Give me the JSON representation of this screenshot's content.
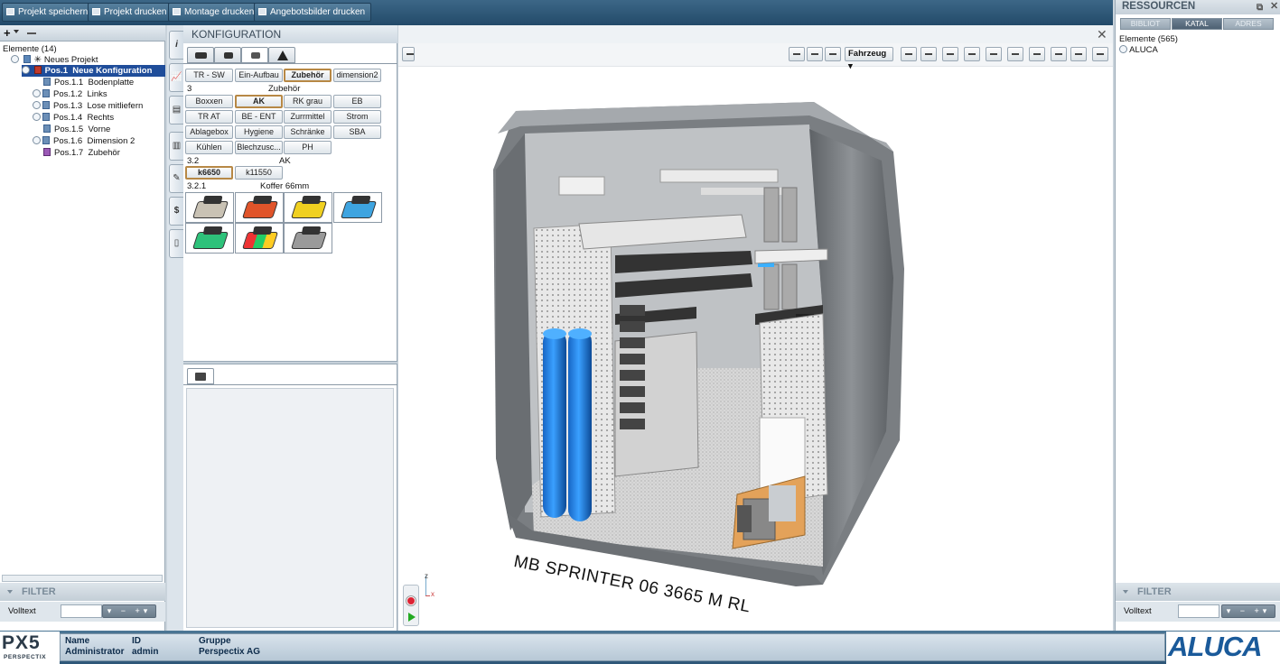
{
  "toolbar": {
    "save": "Projekt speichern",
    "print": "Projekt drucken",
    "assembly_print": "Montage drucken",
    "offer_images_print": "Angebotsbilder drucken"
  },
  "tree": {
    "header": "Elemente (14)",
    "root": "Neues Projekt",
    "selected_code": "Pos.1",
    "selected_label": "Neue Konfiguration",
    "items": [
      {
        "code": "Pos.1.1",
        "label": "Bodenplatte"
      },
      {
        "code": "Pos.1.2",
        "label": "Links"
      },
      {
        "code": "Pos.1.3",
        "label": "Lose mitliefern"
      },
      {
        "code": "Pos.1.4",
        "label": "Rechts"
      },
      {
        "code": "Pos.1.5",
        "label": "Vorne"
      },
      {
        "code": "Pos.1.6",
        "label": "Dimension 2"
      },
      {
        "code": "Pos.1.7",
        "label": "Zubehör"
      }
    ]
  },
  "filter": {
    "title": "FILTER",
    "volltext": "Volltext"
  },
  "config": {
    "title": "KONFIGURATION",
    "top_buttons": [
      "TR - SW",
      "Ein-Aufbau",
      "Zubehör",
      "dimension2"
    ],
    "level1_num": "3",
    "level1_name": "Zubehör",
    "grid_buttons": [
      "Boxxen",
      "AK",
      "RK grau",
      "EB",
      "TR AT",
      "BE - ENT",
      "Zurrmittel",
      "Strom",
      "Ablagebox",
      "Hygiene",
      "Schränke",
      "SBA",
      "Kühlen",
      "Blechzusc...",
      "PH"
    ],
    "level2_num": "3.2",
    "level2_name": "AK",
    "sub_buttons": [
      "k6650",
      "k11550"
    ],
    "level3_num": "3.2.1",
    "level3_name": "Koffer 66mm"
  },
  "viewport": {
    "vehicle_dropdown": "Fahrzeug",
    "vehicle_label": "MB SPRINTER 06 3665 M RL",
    "axis_z": "z",
    "axis_x": "x"
  },
  "resources": {
    "title": "RESSOURCEN",
    "tabs": [
      "BIBLIOT",
      "KATAL",
      "ADRES"
    ],
    "count": "Elemente (565)",
    "item": "ALUCA",
    "filter_title": "FILTER",
    "volltext": "Volltext"
  },
  "status": {
    "logo": "PX5",
    "logo_sub": "PERSPECTIX",
    "name_label": "Name",
    "name_value": "Administrator",
    "id_label": "ID",
    "id_value": "admin",
    "group_label": "Gruppe",
    "group_value": "Perspectix AG",
    "brand": "ALUCA"
  }
}
